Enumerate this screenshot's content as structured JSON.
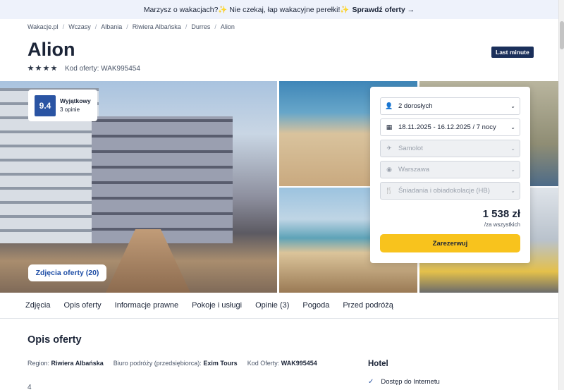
{
  "banner": {
    "text": "Marzysz o wakacjach?✨ Nie czekaj, łap wakacyjne perełki!✨",
    "cta": "Sprawdź oferty →"
  },
  "breadcrumbs": [
    "Wakacje.pl",
    "Wczasy",
    "Albania",
    "Riwiera Albańska",
    "Durres",
    "Alion"
  ],
  "hotel": {
    "name": "Alion",
    "stars": 4,
    "code_label": "Kod oferty: WAK995454",
    "badge": "Last minute"
  },
  "rating": {
    "score": "9.4",
    "label": "Wyjątkowy",
    "reviews": "3 opinie"
  },
  "gallery": {
    "photos_button": "Zdjęcia oferty (20)"
  },
  "booking": {
    "travelers": "2 dorosłych",
    "dates": "18.11.2025 - 16.12.2025 / 7 nocy",
    "transport": "Samolot",
    "departure": "Warszawa",
    "board": "Śniadania i obiadokolacje (HB)",
    "price": "1 538 zł",
    "price_note": "/za wszystkich",
    "reserve": "Zarezerwuj"
  },
  "tabs": [
    "Zdjęcia",
    "Opis oferty",
    "Informacje prawne",
    "Pokoje i usługi",
    "Opinie (3)",
    "Pogoda",
    "Przed podróżą"
  ],
  "description": {
    "title": "Opis oferty",
    "region_label": "Region:",
    "region": "Riwiera Albańska",
    "agency_label": "Biuro podróży (przedsiębiorca):",
    "agency": "Exim Tours",
    "code_label": "Kod Oferty:",
    "code": "WAK995454",
    "stub": "4"
  },
  "hotel_section": {
    "title": "Hotel",
    "amenity": "Dostęp do Internetu"
  }
}
